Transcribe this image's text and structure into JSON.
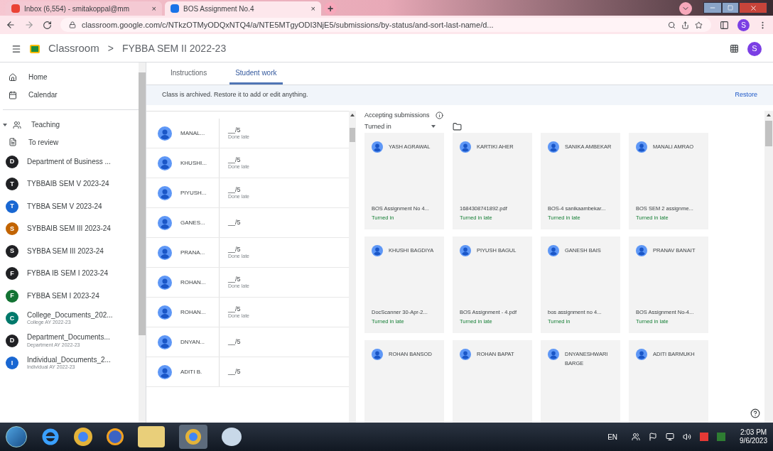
{
  "browser": {
    "tabs": [
      {
        "title": "Inbox (6,554) - smitakoppal@mm",
        "close": "×",
        "selected": false
      },
      {
        "title": "BOS Assignment No.4",
        "close": "×",
        "selected": true
      }
    ],
    "new_tab": "+",
    "url": "classroom.google.com/c/NTkzOTMyODQxNTQ4/a/NTE5MTgyODI3NjE5/submissions/by-status/and-sort-last-name/d...",
    "profile": "S"
  },
  "header": {
    "app": "Classroom",
    "separator": ">",
    "class_name": "FYBBA SEM II 2022-23",
    "avatar": "S"
  },
  "sidebar": {
    "top": [
      {
        "label": "Home"
      },
      {
        "label": "Calendar"
      }
    ],
    "teaching": {
      "label": "Teaching",
      "expanded": true
    },
    "to_review": "To review",
    "classes": [
      {
        "letter": "D",
        "label": "Department of Business ...",
        "color": "#202124"
      },
      {
        "letter": "T",
        "label": "TYBBAIB SEM V 2023-24",
        "color": "#202124"
      },
      {
        "letter": "T",
        "label": "TYBBA SEM V 2023-24",
        "color": "#1967d2"
      },
      {
        "letter": "S",
        "label": "SYBBAIB SEM III 2023-24",
        "color": "#c26401"
      },
      {
        "letter": "S",
        "label": "SYBBA SEM III 2023-24",
        "color": "#202124"
      },
      {
        "letter": "F",
        "label": "FYBBA IB SEM I 2023-24",
        "color": "#202124"
      },
      {
        "letter": "F",
        "label": "FYBBA SEM I 2023-24",
        "color": "#137333"
      },
      {
        "letter": "C",
        "label": "College_Documents_202...",
        "subtitle": "College AY 2022-23",
        "color": "#00796b"
      },
      {
        "letter": "D",
        "label": "Department_Documents...",
        "subtitle": "Department AY 2022-23",
        "color": "#202124"
      },
      {
        "letter": "I",
        "label": "Individual_Documents_2...",
        "subtitle": "Individual AY 2022-23",
        "color": "#1967d2"
      }
    ]
  },
  "page_tabs": [
    {
      "label": "Instructions",
      "selected": false
    },
    {
      "label": "Student work",
      "selected": true
    }
  ],
  "banner": {
    "message": "Class is archived. Restore it to add or edit anything.",
    "action": "Restore"
  },
  "students": [
    {
      "name": "MANAL...",
      "grade": "__/5",
      "status": "Done late"
    },
    {
      "name": "KHUSHI...",
      "grade": "__/5",
      "status": "Done late"
    },
    {
      "name": "PIYUSH...",
      "grade": "__/5",
      "status": "Done late"
    },
    {
      "name": "GANES...",
      "grade": "__/5"
    },
    {
      "name": "PRANA...",
      "grade": "__/5",
      "status": "Done late"
    },
    {
      "name": "ROHAN...",
      "grade": "__/5",
      "status": "Done late"
    },
    {
      "name": "ROHAN...",
      "grade": "__/5",
      "status": "Done late"
    },
    {
      "name": "DNYAN...",
      "grade": "__/5"
    },
    {
      "name": "ADITI B.",
      "grade": "__/5"
    }
  ],
  "submissions": {
    "accepting": "Accepting submissions",
    "filter": "Turned in",
    "cards": [
      {
        "name": "YASH AGRAWAL",
        "file": "BOS Assignment No 4...",
        "status": "Turned in"
      },
      {
        "name": "KARTIKI AHER",
        "file": "1684308741892.pdf",
        "status": "Turned in late"
      },
      {
        "name": "SANIKA AMBEKAR",
        "file": "BOS-4 sanikaambekar...",
        "status": "Turned in late"
      },
      {
        "name": "MANALI AMRAO",
        "file": "BOS SEM 2 assignme...",
        "status": "Turned in late"
      },
      {
        "name": "KHUSHI BAGDIYA",
        "file": "DocScanner 30-Apr-2...",
        "status": "Turned in late"
      },
      {
        "name": "PIYUSH BAGUL",
        "file": "BOS Assignment - 4.pdf",
        "status": "Turned in late"
      },
      {
        "name": "GANESH BAIS",
        "file": "bos assignment no 4...",
        "status": "Turned in"
      },
      {
        "name": "PRANAV BANAIT",
        "file": "BOS Assignment No-4...",
        "status": "Turned in late"
      },
      {
        "name": "ROHAN BANSOD"
      },
      {
        "name": "ROHAN BAPAT"
      },
      {
        "name": "DNYANESHWARI BARGE"
      },
      {
        "name": "ADITI BARMUKH"
      }
    ]
  },
  "taskbar": {
    "language": "EN",
    "time": "2:03 PM",
    "date": "9/6/2023"
  }
}
